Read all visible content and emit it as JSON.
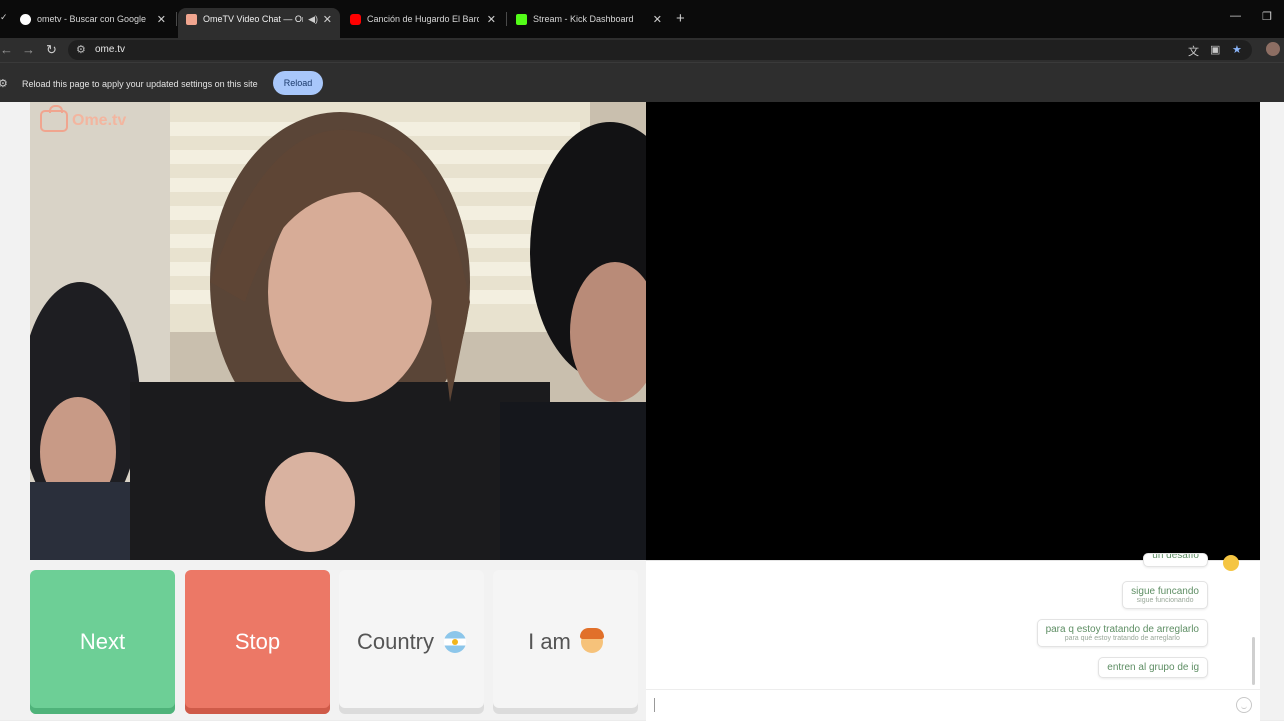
{
  "browser": {
    "tabs": [
      {
        "title": "ometv - Buscar con Google",
        "icon": "google-icon",
        "icon_color": "#ffffff",
        "active": false
      },
      {
        "title": "OmeTV Video Chat — Ome",
        "icon": "ometv-icon",
        "icon_color": "#f0a58f",
        "active": true,
        "audio": true
      },
      {
        "title": "Canción de Hugardo El Bardo",
        "icon": "youtube-icon",
        "icon_color": "#ff0000",
        "active": false
      },
      {
        "title": "Stream - Kick Dashboard",
        "icon": "kick-icon",
        "icon_color": "#53fc18",
        "active": false
      }
    ],
    "url": "ome.tv",
    "infobar": {
      "text": "Reload this page to apply your updated settings on this site",
      "button": "Reload"
    }
  },
  "page": {
    "logo": "Ome.tv",
    "controls": {
      "next": "Next",
      "stop": "Stop",
      "country": "Country",
      "country_flag": "argentina-flag",
      "iam": "I am",
      "iam_icon": "boy-emoji"
    },
    "chat": {
      "messages": [
        {
          "text": "sigue funcando",
          "translation": "sigue funcionando"
        },
        {
          "text": "para q estoy tratando de arreglarlo",
          "translation": "para qué estoy tratando de arreglarlo"
        },
        {
          "text": "entren al grupo de ig",
          "translation": ""
        }
      ],
      "partial_message": "un desafío",
      "input_placeholder": ""
    }
  },
  "colors": {
    "next": "#6dcf96",
    "stop": "#ec7866",
    "reload_button": "#a8c7fa"
  }
}
